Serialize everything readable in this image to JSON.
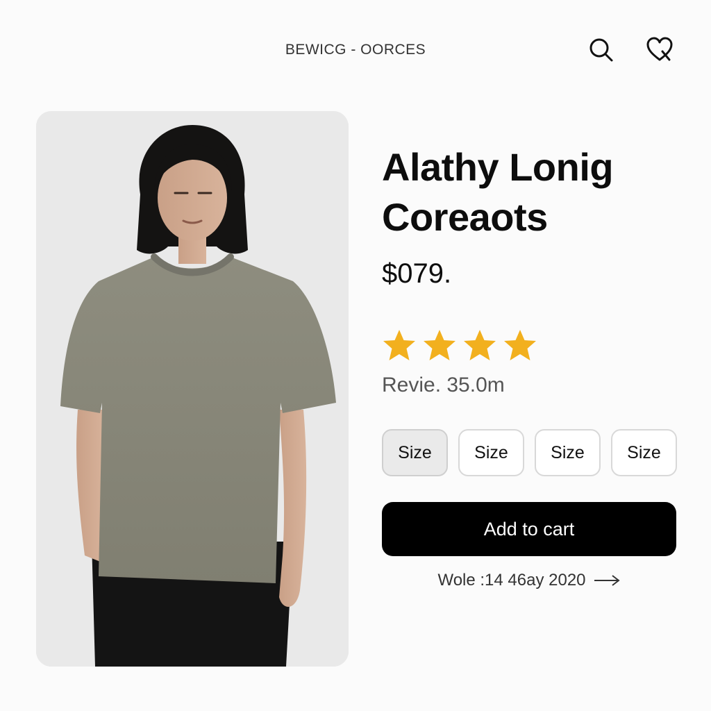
{
  "header": {
    "brand": "BEWICG - OORCES",
    "search_icon": "search-icon",
    "wishlist_icon": "heart-icon"
  },
  "product": {
    "image": "product-photo",
    "title_line1": "Alathy Lonig",
    "title_line2": "Coreaots",
    "price": "$079.",
    "rating": 4,
    "rating_max": 4,
    "reviews_text": "Revie. 35.0m",
    "sizes": [
      {
        "label": "Size",
        "selected": true
      },
      {
        "label": "Size",
        "selected": false
      },
      {
        "label": "Size",
        "selected": false
      },
      {
        "label": "Size",
        "selected": false
      }
    ],
    "add_to_cart": "Add to cart",
    "link_text": "Wole :14 46ay 2020",
    "link_icon": "arrow-right-icon"
  },
  "colors": {
    "accent": "#000000",
    "star": "#f2b01e",
    "background": "#fbfbfb",
    "shirt": "#8c8b7c"
  }
}
